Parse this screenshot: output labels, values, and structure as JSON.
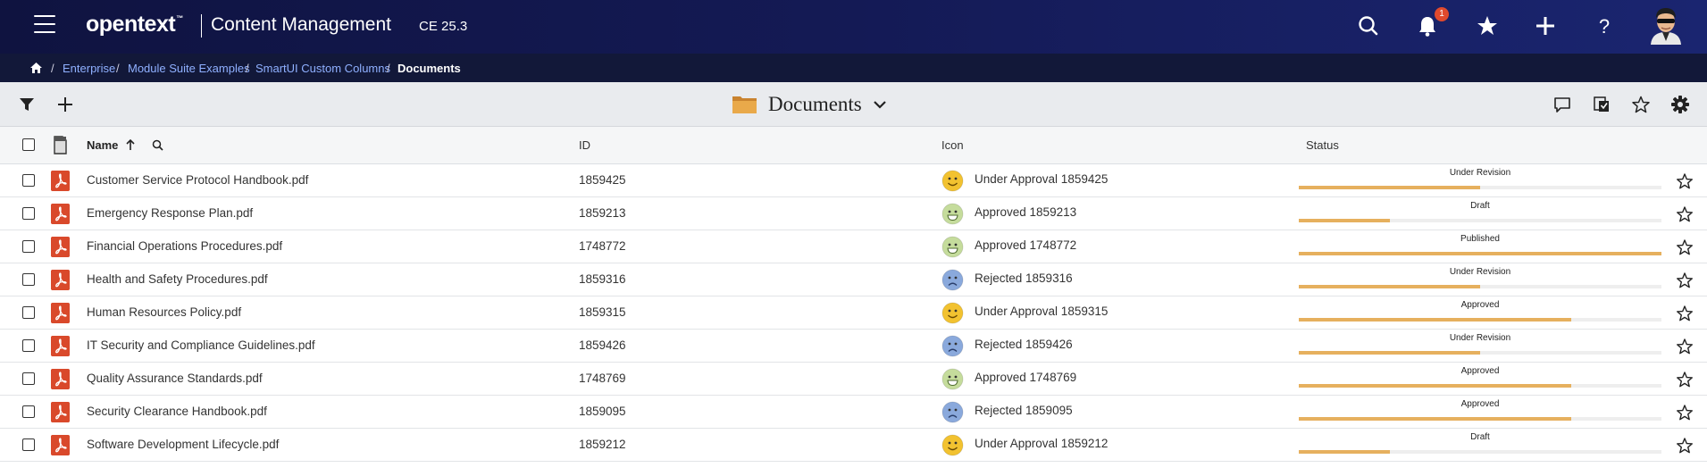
{
  "header": {
    "logo_text": "opentext",
    "logo_tm": "™",
    "app_title": "Content Management",
    "version": "CE 25.3",
    "notification_count": "1",
    "icons": [
      "menu-icon",
      "search-icon",
      "bell-icon",
      "star-icon",
      "plus-icon",
      "help-icon",
      "user-avatar"
    ]
  },
  "breadcrumb": {
    "items": [
      "Enterprise",
      "Module Suite Examples",
      "SmartUI Custom Columns"
    ],
    "separator": "/",
    "current": "Documents"
  },
  "toolbar": {
    "folder_title": "Documents",
    "left_icons": [
      "filter-icon",
      "add-icon"
    ],
    "right_icons": [
      "comment-icon",
      "collections-icon",
      "favorite-icon",
      "settings-icon"
    ]
  },
  "table": {
    "columns": {
      "name": "Name",
      "id": "ID",
      "icon": "Icon",
      "status": "Status"
    },
    "sort": "ascending",
    "rows": [
      {
        "name": "Customer Service Protocol Handbook.pdf",
        "id": "1859425",
        "icon_text": "Under Approval 1859425",
        "face": "happy-yellow",
        "status_label": "Under Revision",
        "progress": 0.5
      },
      {
        "name": "Emergency Response Plan.pdf",
        "id": "1859213",
        "icon_text": "Approved 1859213",
        "face": "grin-green",
        "status_label": "Draft",
        "progress": 0.25
      },
      {
        "name": "Financial Operations Procedures.pdf",
        "id": "1748772",
        "icon_text": "Approved 1748772",
        "face": "grin-green",
        "status_label": "Published",
        "progress": 1.0
      },
      {
        "name": "Health and Safety Procedures.pdf",
        "id": "1859316",
        "icon_text": "Rejected 1859316",
        "face": "sad-blue",
        "status_label": "Under Revision",
        "progress": 0.5
      },
      {
        "name": "Human Resources Policy.pdf",
        "id": "1859315",
        "icon_text": "Under Approval 1859315",
        "face": "happy-yellow",
        "status_label": "Approved",
        "progress": 0.75
      },
      {
        "name": "IT Security and Compliance Guidelines.pdf",
        "id": "1859426",
        "icon_text": "Rejected 1859426",
        "face": "sad-blue",
        "status_label": "Under Revision",
        "progress": 0.5
      },
      {
        "name": "Quality Assurance Standards.pdf",
        "id": "1748769",
        "icon_text": "Approved 1748769",
        "face": "grin-green",
        "status_label": "Approved",
        "progress": 0.75
      },
      {
        "name": "Security Clearance Handbook.pdf",
        "id": "1859095",
        "icon_text": "Rejected 1859095",
        "face": "sad-blue",
        "status_label": "Approved",
        "progress": 0.75
      },
      {
        "name": "Software Development Lifecycle.pdf",
        "id": "1859212",
        "icon_text": "Under Approval 1859212",
        "face": "happy-yellow",
        "status_label": "Draft",
        "progress": 0.25
      }
    ]
  },
  "colors": {
    "header_bg": "#141a55",
    "breadcrumb_bg": "#121839",
    "link": "#8fb0ff",
    "pdf_red": "#d9492b",
    "progress_fill": "#e6b05e",
    "face_yellow": "#f2c230",
    "face_green": "#c5dc9c",
    "face_blue": "#8aa9dc"
  }
}
